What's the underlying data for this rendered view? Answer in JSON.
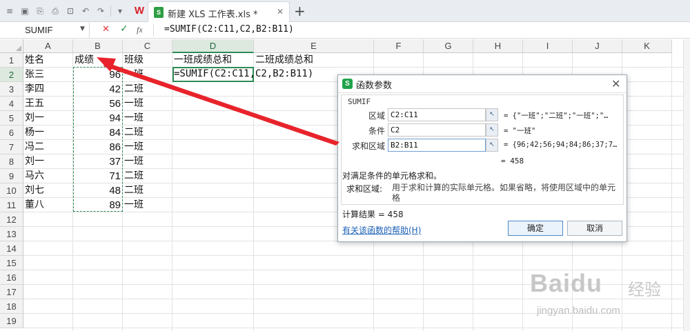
{
  "titlebar": {
    "doc_tab_label": "新建 XLS 工作表.xls *",
    "doc_type_badge": "S",
    "app_logo": "W",
    "close_glyph": "✕",
    "new_tab_glyph": "+"
  },
  "formula_bar": {
    "name_box": "SUMIF",
    "cancel_glyph": "✕",
    "confirm_glyph": "✓",
    "fx_label": "fx",
    "formula": "=SUMIF(C2:C11,C2,B2:B11)"
  },
  "columns": [
    "A",
    "B",
    "C",
    "D",
    "E",
    "F",
    "G",
    "H",
    "I",
    "J",
    "K"
  ],
  "rows": [
    "1",
    "2",
    "3",
    "4",
    "5",
    "6",
    "7",
    "8",
    "9",
    "10",
    "11",
    "12",
    "13",
    "14",
    "15",
    "16",
    "17",
    "18",
    "19"
  ],
  "cells": {
    "headers": {
      "A1": "姓名",
      "B1": "成绩",
      "C1": "班级",
      "D1": "一班成绩总和",
      "E1": "二班成绩总和"
    },
    "records": [
      {
        "name": "张三",
        "score": "96",
        "class": "一班"
      },
      {
        "name": "李四",
        "score": "42",
        "class": "二班"
      },
      {
        "name": "王五",
        "score": "56",
        "class": "一班"
      },
      {
        "name": "刘一",
        "score": "94",
        "class": "一班"
      },
      {
        "name": "杨一",
        "score": "84",
        "class": "二班"
      },
      {
        "name": "冯二",
        "score": "86",
        "class": "一班"
      },
      {
        "name": "刘一",
        "score": "37",
        "class": "一班"
      },
      {
        "name": "马六",
        "score": "71",
        "class": "二班"
      },
      {
        "name": "刘七",
        "score": "48",
        "class": "二班"
      },
      {
        "name": "董八",
        "score": "89",
        "class": "一班"
      }
    ],
    "D2_editing": "=SUMIF(C2:C11,C2,B2:B11)"
  },
  "active_cell": "D2",
  "dialog": {
    "title": "函数参数",
    "logo": "S",
    "function_name": "SUMIF",
    "args": [
      {
        "label": "区域",
        "value": "C2:C11",
        "preview": "= {\"一班\";\"二班\";\"一班\";\"…"
      },
      {
        "label": "条件",
        "value": "C2",
        "preview": "= \"一班\""
      },
      {
        "label": "求和区域",
        "value": "B2:B11",
        "preview": "= {96;42;56;94;84;86;37;7…"
      }
    ],
    "collapse_glyph": "↖",
    "preview_result": "= 458",
    "description": "对满足条件的单元格求和。",
    "arg_desc_label": "求和区域:",
    "arg_desc": "用于求和计算的实际单元格。如果省略，将使用区域中的单元格",
    "result": "计算结果 = 458",
    "help_link": "有关该函数的帮助(H)",
    "ok_label": "确定",
    "cancel_label": "取消"
  },
  "watermark": {
    "logo": "Baidu",
    "cn": "经验",
    "url": "jingyan.baidu.com"
  },
  "colors": {
    "accent_green": "#2e8b57",
    "arrow_red": "#e8232b",
    "link_blue": "#1a5fb4"
  }
}
